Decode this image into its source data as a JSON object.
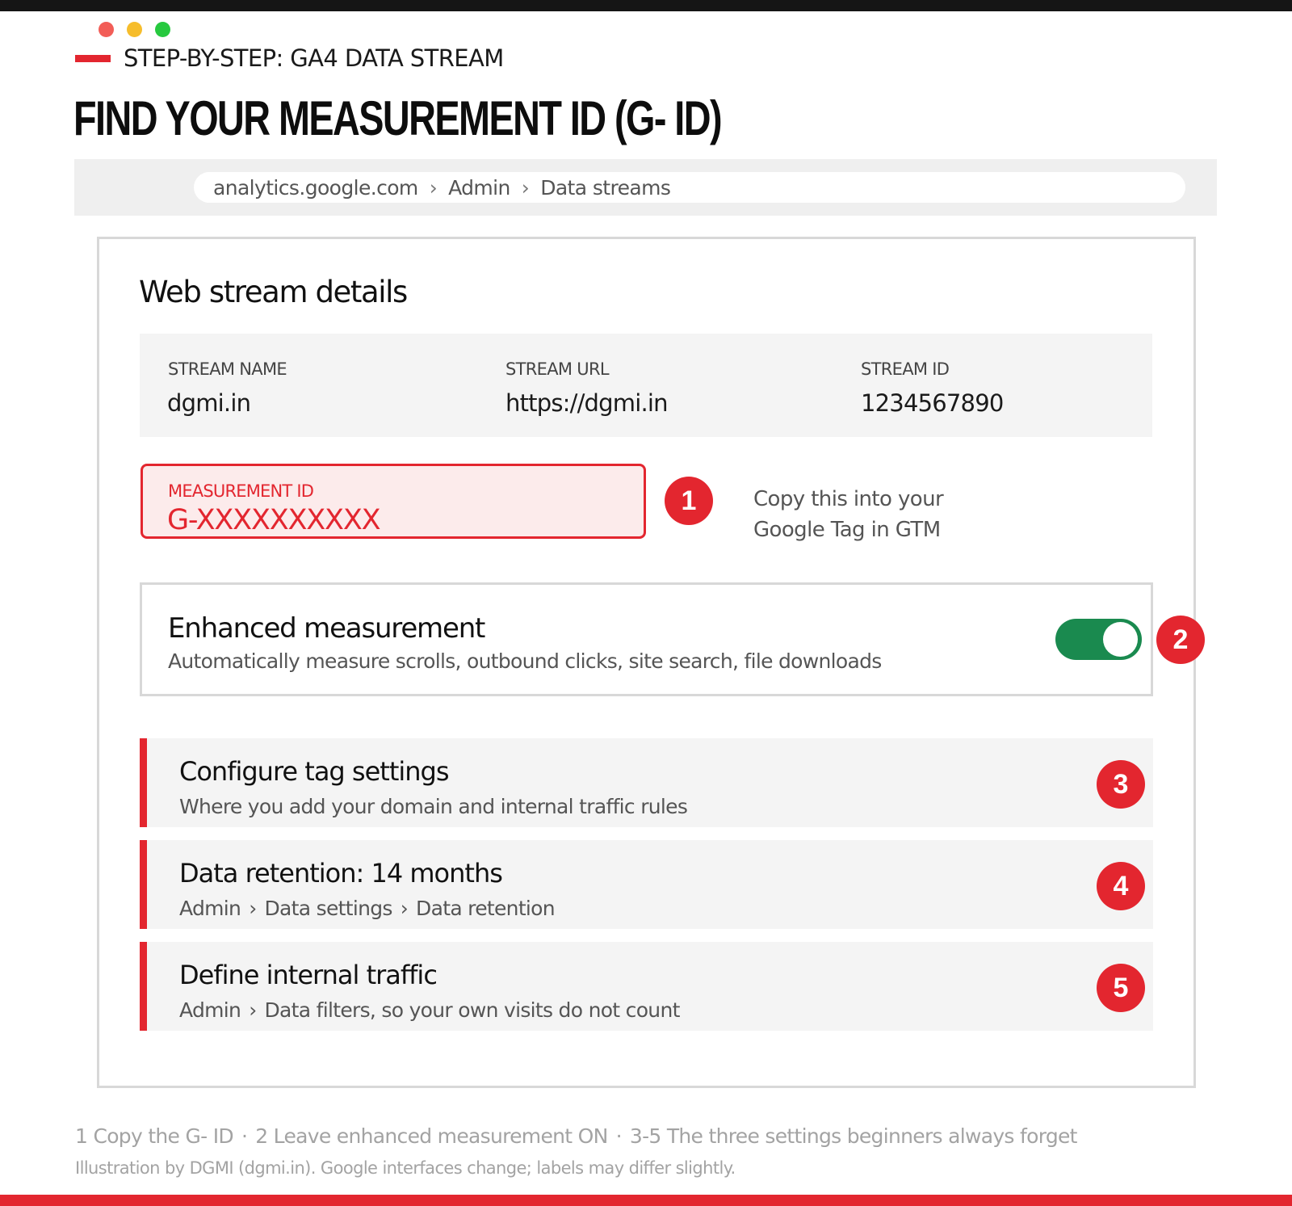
{
  "header": {
    "kicker": "STEP-BY-STEP: GA4 DATA STREAM",
    "title": "FIND YOUR MEASUREMENT ID (G- ID)"
  },
  "browser": {
    "breadcrumb": [
      "analytics.google.com",
      "Admin",
      "Data streams"
    ],
    "separator": "›"
  },
  "panel": {
    "title": "Web stream details",
    "stream": {
      "name_label": "STREAM NAME",
      "name_value": "dgmi.in",
      "url_label": "STREAM URL",
      "url_value": "https://dgmi.in",
      "id_label": "STREAM ID",
      "id_value": "1234567890"
    },
    "measurement": {
      "label": "MEASUREMENT ID",
      "value": "G-XXXXXXXXXX",
      "badge": "1",
      "hint_line1": "Copy this into your",
      "hint_line2": "Google Tag in GTM"
    },
    "enhanced": {
      "title": "Enhanced measurement",
      "description": "Automatically measure scrolls, outbound clicks, site search, file downloads",
      "toggle_on": true,
      "badge": "2"
    },
    "settings": [
      {
        "title": "Configure tag settings",
        "description": "Where you add your domain and internal traffic rules",
        "badge": "3"
      },
      {
        "title": "Data retention: 14 months",
        "path": [
          "Admin",
          "Data settings",
          "Data retention"
        ],
        "badge": "4"
      },
      {
        "title": "Define internal traffic",
        "path_start": "Admin",
        "path_rest": "Data filters, so your own visits do not count",
        "badge": "5"
      }
    ]
  },
  "footer": {
    "note1": "1 Copy the G- ID",
    "note2": "2 Leave enhanced measurement ON",
    "note3": "3-5 The three settings beginners always forget",
    "dot": "·",
    "credit": "Illustration by DGMI (dgmi.in). Google interfaces change; labels may differ slightly."
  },
  "colors": {
    "accent": "#e3262f",
    "toggle_on": "#1a8a4f",
    "muted_text": "#a3a3a3"
  }
}
